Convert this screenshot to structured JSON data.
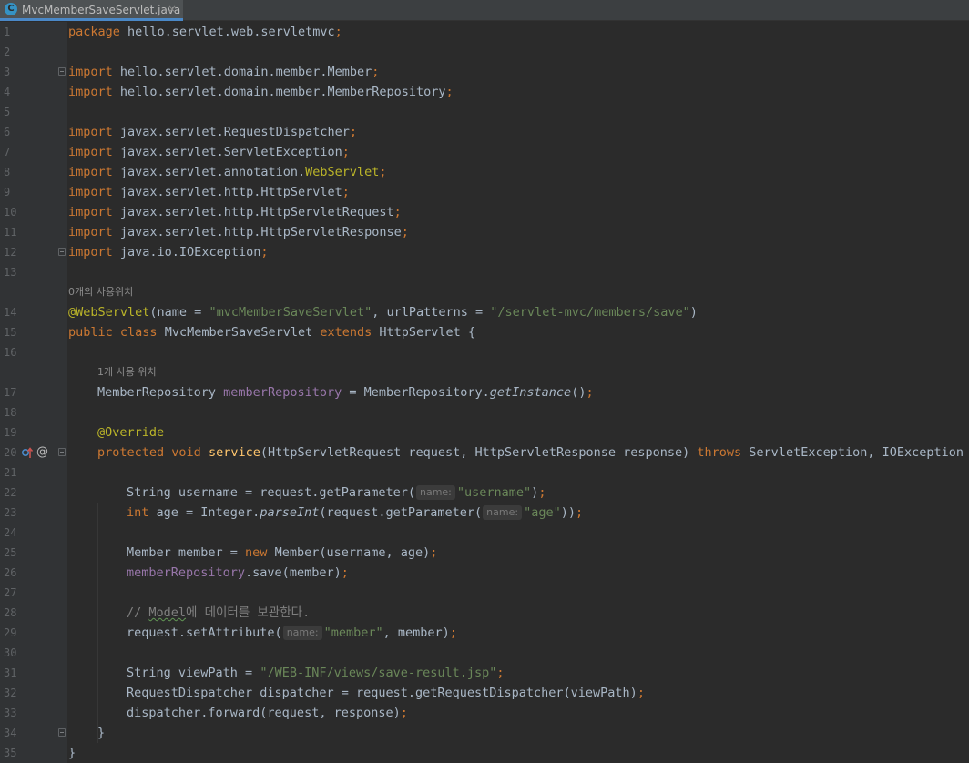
{
  "tab": {
    "file_icon": "java-class-icon",
    "icon_letter": "C",
    "filename": "MvcMemberSaveServlet.java",
    "close_glyph": "×"
  },
  "hints": {
    "class_usages": "0개의 사용위치",
    "field_usages": "1개 사용 위치",
    "param_name": "name:"
  },
  "gutter_icons": [
    "override-method-icon",
    "annotation-icon"
  ],
  "code": {
    "l1_kw": "package",
    "l1_rest": " hello.servlet.web.servletmvc",
    "import_kw": "import",
    "l3": " hello.servlet.domain.member.Member",
    "l4": " hello.servlet.domain.member.MemberRepository",
    "l6": " javax.servlet.RequestDispatcher",
    "l7": " javax.servlet.ServletException",
    "l8a": " javax.servlet.annotation.",
    "l8b": "WebServlet",
    "l9": " javax.servlet.http.HttpServlet",
    "l10": " javax.servlet.http.HttpServletRequest",
    "l11": " javax.servlet.http.HttpServletResponse",
    "l12": " java.io.IOException",
    "semi": ";",
    "l14_ann": "@WebServlet",
    "l14_a": "(name = ",
    "l14_s1": "\"mvcMemberSaveServlet\"",
    "l14_b": ", urlPatterns = ",
    "l14_s2": "\"/servlet-mvc/members/save\"",
    "l14_c": ")",
    "l15_public": "public",
    "l15_class": " class",
    "l15_a": " MvcMemberSaveServlet ",
    "l15_extends": "extends",
    "l15_b": " HttpServlet {",
    "l17_a": "MemberRepository ",
    "l17_fld": "memberRepository",
    "l17_b": " = MemberRepository.",
    "l17_m": "getInstance",
    "l17_c": "()",
    "l19_ann": "@Override",
    "l20_protected": "protected",
    "l20_void": " void",
    "l20_a": " ",
    "l20_m": "service",
    "l20_b": "(HttpServletRequest request, HttpServletResponse response) ",
    "l20_throws": "throws",
    "l20_c": " ServletException, IOException {",
    "l22_a": "String username = request.getParameter(",
    "l22_s": "\"username\"",
    "l22_b": ")",
    "l23_int": "int",
    "l23_a": " age = Integer.",
    "l23_m": "parseInt",
    "l23_b": "(request.getParameter(",
    "l23_s": "\"age\"",
    "l23_c": "))",
    "l25_a": "Member member = ",
    "l25_new": "new",
    "l25_b": " Member(username, age)",
    "l26_fld": "memberRepository",
    "l26_a": ".save(member)",
    "l28_a": "// ",
    "l28_typo": "Model",
    "l28_b": "에 데이터를 보관한다.",
    "l29_a": "request.setAttribute(",
    "l29_s": "\"member\"",
    "l29_b": ", member)",
    "l31_a": "String viewPath = ",
    "l31_s": "\"/WEB-INF/views/save-result.jsp\"",
    "l32_a": "RequestDispatcher dispatcher = request.getRequestDispatcher(viewPath)",
    "l33_a": "dispatcher.forward(request, response)",
    "close_brace": "}",
    "comma": ","
  },
  "line_numbers": [
    "1",
    "2",
    "3",
    "4",
    "5",
    "6",
    "7",
    "8",
    "9",
    "10",
    "11",
    "12",
    "13",
    "14",
    "15",
    "16",
    "17",
    "18",
    "19",
    "20",
    "21",
    "22",
    "23",
    "24",
    "25",
    "26",
    "27",
    "28",
    "29",
    "30",
    "31",
    "32",
    "33",
    "34",
    "35"
  ],
  "colors": {
    "background": "#2b2b2b",
    "keyword": "#cc7832",
    "annotation": "#bbb529",
    "string": "#6a8759",
    "field": "#9876aa",
    "method": "#ffc66d",
    "comment": "#808080",
    "text": "#a9b7c6",
    "tab_underline": "#4a88c7"
  }
}
